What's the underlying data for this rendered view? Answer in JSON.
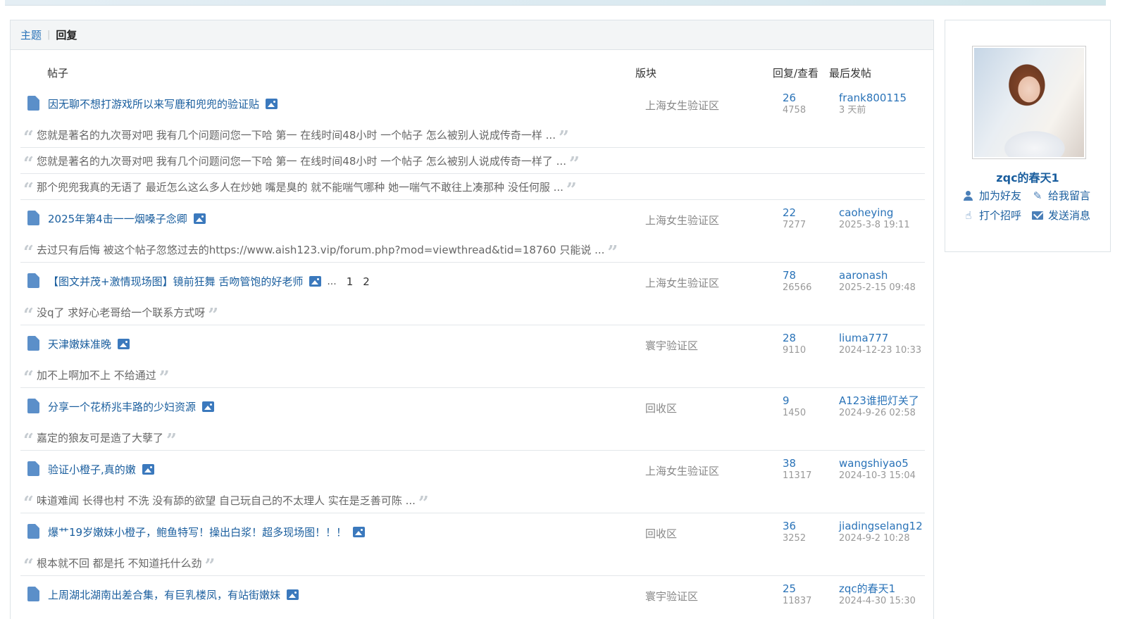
{
  "tabs": [
    {
      "label": "主题",
      "active": false
    },
    {
      "label": "回复",
      "active": true
    }
  ],
  "tab_separator": "|",
  "columns": {
    "post": "帖子",
    "forum": "版块",
    "replies_views": "回复/查看",
    "last_post": "最后发帖"
  },
  "threads": [
    {
      "title": "因无聊不想打游戏所以来写鹿和兜兜的验证贴",
      "has_image": true,
      "forum": "上海女生验证区",
      "replies": "26",
      "views": "4758",
      "last_user": "frank800115",
      "last_time": "3 天前",
      "snippets": [
        "您就是著名的九次哥对吧 我有几个问题问您一下哈 第一 在线时间48小时 一个帖子 怎么被别人说成传奇一样 ...",
        "您就是著名的九次哥对吧 我有几个问题问您一下哈 第一 在线时间48小时 一个帖子 怎么被别人说成传奇一样了 ...",
        "那个兜兜我真的无语了 最近怎么这么多人在炒她 嘴是臭的 就不能喘气哪种 她一喘气不敢往上凑那种 没任何服 ..."
      ]
    },
    {
      "title": "2025年第4击一一烟嗓子念卿",
      "has_image": true,
      "forum": "上海女生验证区",
      "replies": "22",
      "views": "7277",
      "last_user": "caoheying",
      "last_time": "2025-3-8 19:11",
      "snippets": [
        "去过只有后悔 被这个帖子忽悠过去的https://www.aish123.vip/forum.php?mod=viewthread&tid=18760 只能说 ..."
      ]
    },
    {
      "title": "【图文并茂+激情现场图】镜前狂舞 舌吻管饱的好老师",
      "has_image": true,
      "pages": [
        "1",
        "2"
      ],
      "page_ellipsis": "...",
      "forum": "上海女生验证区",
      "replies": "78",
      "views": "26566",
      "last_user": "aaronash",
      "last_time": "2025-2-15 09:48",
      "snippets": [
        "没q了 求好心老哥给一个联系方式呀"
      ]
    },
    {
      "title": "天津嫩妹准晚",
      "has_image": true,
      "forum": "寰宇验证区",
      "replies": "28",
      "views": "9110",
      "last_user": "liuma777",
      "last_time": "2024-12-23 10:33",
      "snippets": [
        "加不上啊加不上 不给通过"
      ]
    },
    {
      "title": "分享一个花桥兆丰路的少妇资源",
      "has_image": true,
      "forum": "回收区",
      "replies": "9",
      "views": "1450",
      "last_user": "A123谁把灯关了",
      "last_time": "2024-9-26 02:58",
      "snippets": [
        "嘉定的狼友可是造了大孽了"
      ]
    },
    {
      "title": "验证小橙子,真的嫩",
      "has_image": true,
      "forum": "上海女生验证区",
      "replies": "38",
      "views": "11317",
      "last_user": "wangshiyao5",
      "last_time": "2024-10-3 15:04",
      "snippets": [
        "味道难闻 长得也村 不洗 没有舔的欲望 自己玩自己的不太理人 实在是乏善可陈 ..."
      ]
    },
    {
      "title": "爆艹19岁嫩妹小橙子，鲍鱼特写！操出白浆！超多现场图！！！",
      "has_image": true,
      "forum": "回收区",
      "replies": "36",
      "views": "3252",
      "last_user": "jiadingselang12",
      "last_time": "2024-9-2 10:28",
      "snippets": [
        "根本就不回 都是托 不知道托什么劲"
      ]
    },
    {
      "title": "上周湖北湖南出差合集，有巨乳楼凤，有站街嫩妹",
      "has_image": true,
      "forum": "寰宇验证区",
      "replies": "25",
      "views": "11837",
      "last_user": "zqc的春天1",
      "last_time": "2024-4-30 15:30",
      "snippets": []
    }
  ],
  "profile": {
    "username": "zqc的春天1",
    "actions": [
      {
        "label": "加为好友",
        "icon": "add-friend-icon"
      },
      {
        "label": "给我留言",
        "icon": "pencil-icon"
      },
      {
        "label": "打个招呼",
        "icon": "wave-hand-icon"
      },
      {
        "label": "发送消息",
        "icon": "mail-icon"
      }
    ]
  },
  "colors": {
    "link": "#1a5e9e",
    "accent": "#2a73b8",
    "muted": "#999999"
  }
}
